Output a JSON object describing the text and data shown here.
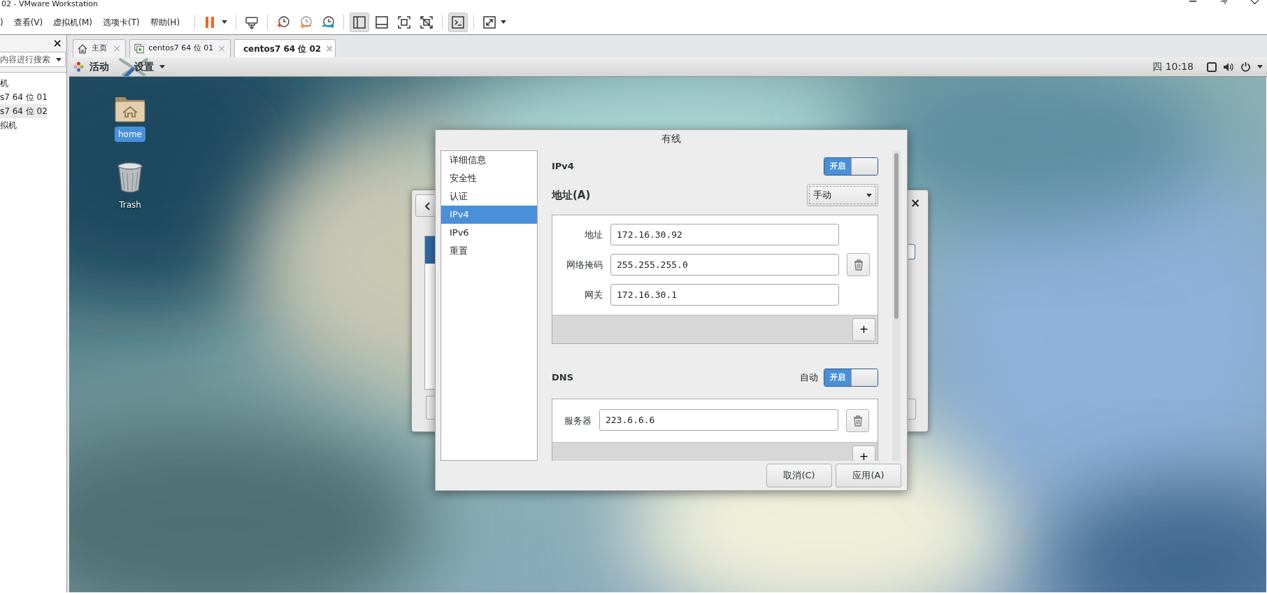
{
  "window": {
    "title": "02 - VMware Workstation"
  },
  "menu_bar": [
    ")",
    "查看(V)",
    "虚拟机(M)",
    "选项卡(T)",
    "帮助(H)"
  ],
  "toolbar_groups": [
    {
      "buttons": [
        {
          "pressed": false
        }
      ]
    },
    {
      "buttons": [
        {
          "pressed": false
        }
      ]
    },
    {
      "buttons": [
        {
          "pressed": false
        },
        {
          "pressed": false
        },
        {
          "pressed": false
        }
      ]
    },
    {
      "buttons": [
        {
          "pressed": true
        },
        {
          "pressed": false
        },
        {
          "pressed": false
        },
        {
          "pressed": false
        }
      ]
    },
    {
      "buttons": [
        {
          "pressed": true
        }
      ]
    },
    {
      "buttons": [
        {
          "pressed": false
        }
      ]
    }
  ],
  "library": {
    "close": "×",
    "search": {
      "placeholder": "内容进行搜索"
    },
    "items": [
      {
        "label": "机",
        "selected": false
      },
      {
        "label": "s7 64 位 01",
        "selected": false
      },
      {
        "label": "s7 64 位 02",
        "selected": true
      },
      {
        "label": "拟机",
        "selected": false
      }
    ]
  },
  "tabs": [
    {
      "label": "主页",
      "kind": "home",
      "selected": false,
      "close": "×"
    },
    {
      "label": "centos7 64 位 01",
      "kind": "vm",
      "selected": false,
      "close": "×"
    },
    {
      "label": "centos7 64 位 02",
      "kind": "vm",
      "selected": true,
      "close": "×"
    }
  ],
  "gnome_bar": {
    "activities": "活动",
    "app_menu": "设置",
    "clock": "四 10:18"
  },
  "desktop_icons": [
    {
      "label": "home",
      "kind": "folder",
      "selected": true
    },
    {
      "label": "Trash",
      "kind": "trash",
      "selected": false
    }
  ],
  "background_window": {
    "close": "×"
  },
  "dialog": {
    "title": "有线",
    "sections": [
      {
        "label": "详细信息",
        "selected": false
      },
      {
        "label": "安全性",
        "selected": false
      },
      {
        "label": "认证",
        "selected": false
      },
      {
        "label": "IPv4",
        "selected": true
      },
      {
        "label": "IPv6",
        "selected": false
      },
      {
        "label": "重置",
        "selected": false
      }
    ],
    "ipv4": {
      "heading": "IPv4",
      "switch": {
        "label": "开启",
        "on": true
      },
      "method_label": "地址(A)",
      "method": "手动",
      "fields": [
        {
          "label": "地址",
          "value": "172.16.30.92"
        },
        {
          "label": "网络掩码",
          "value": "255.255.255.0"
        },
        {
          "label": "网关",
          "value": "172.16.30.1"
        }
      ],
      "add": "+"
    },
    "dns": {
      "heading": "DNS",
      "auto_label": "自动",
      "switch": {
        "label": "开启",
        "on": true
      },
      "servers": [
        {
          "label": "服务器",
          "value": "223.6.6.6"
        }
      ],
      "add": "+"
    },
    "buttons": [
      "取消(C)",
      "应用(A)"
    ]
  }
}
